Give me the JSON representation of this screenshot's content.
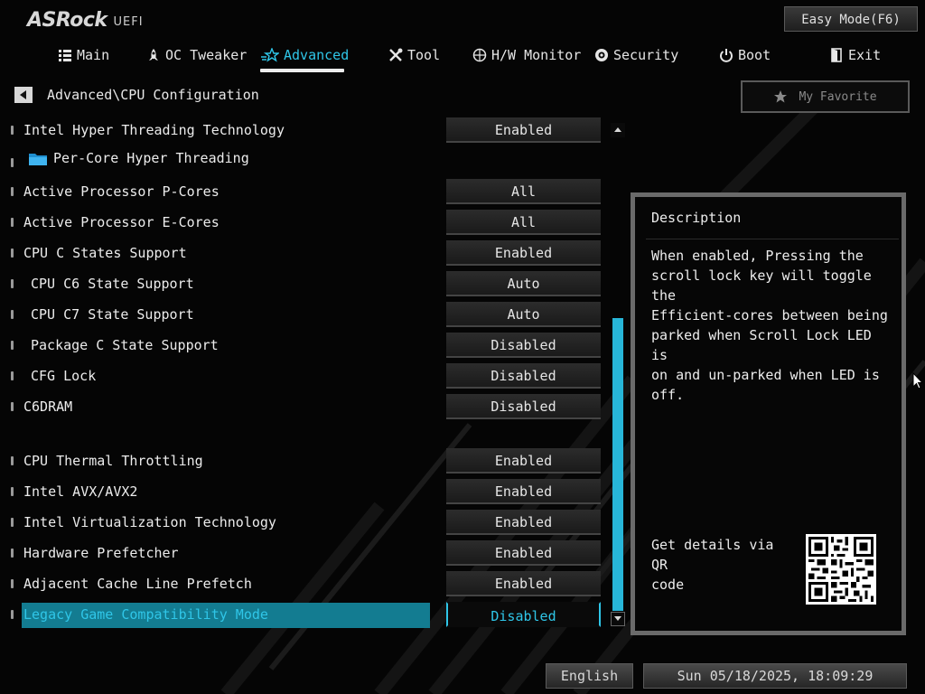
{
  "app": {
    "brand": "ASRock",
    "product": "UEFI"
  },
  "header": {
    "easy_mode_label": "Easy Mode(F6)"
  },
  "nav": {
    "tabs": [
      {
        "label": "Main",
        "icon": "list-icon"
      },
      {
        "label": "OC Tweaker",
        "icon": "rocket-icon"
      },
      {
        "label": "Advanced",
        "icon": "star-icon",
        "active": true
      },
      {
        "label": "Tool",
        "icon": "tools-icon"
      },
      {
        "label": "H/W Monitor",
        "icon": "monitor-icon"
      },
      {
        "label": "Security",
        "icon": "shield-icon"
      },
      {
        "label": "Boot",
        "icon": "power-icon"
      },
      {
        "label": "Exit",
        "icon": "exit-door-icon"
      }
    ]
  },
  "breadcrumb": {
    "path": "Advanced\\CPU Configuration"
  },
  "favorite": {
    "label": "My Favorite"
  },
  "settings": [
    {
      "label": "Intel Hyper Threading Technology",
      "value": "Enabled"
    },
    {
      "label": "Per-Core Hyper Threading",
      "value": null,
      "folder": true
    },
    {
      "label": "Active Processor P-Cores",
      "value": "All"
    },
    {
      "label": "Active Processor E-Cores",
      "value": "All"
    },
    {
      "label": "CPU C States Support",
      "value": "Enabled"
    },
    {
      "label": "CPU C6 State Support",
      "value": "Auto",
      "indent": true
    },
    {
      "label": "CPU C7 State Support",
      "value": "Auto",
      "indent": true
    },
    {
      "label": "Package C State Support",
      "value": "Disabled",
      "indent": true
    },
    {
      "label": "CFG Lock",
      "value": "Disabled",
      "indent": true
    },
    {
      "label": "C6DRAM",
      "value": "Disabled"
    },
    {
      "label": "CPU Thermal Throttling",
      "value": "Enabled"
    },
    {
      "label": "Intel AVX/AVX2",
      "value": "Enabled"
    },
    {
      "label": "Intel Virtualization Technology",
      "value": "Enabled"
    },
    {
      "label": "Hardware Prefetcher",
      "value": "Enabled"
    },
    {
      "label": "Adjacent Cache Line Prefetch",
      "value": "Enabled"
    },
    {
      "label": "Legacy Game Compatibility Mode",
      "value": "Disabled",
      "selected": true
    }
  ],
  "description": {
    "title": "Description",
    "text": "When enabled, Pressing the\nscroll lock key will toggle the\nEfficient-cores between being\nparked when Scroll Lock LED is\non and un-parked when LED is\noff.",
    "qr_caption": "Get details via QR\ncode"
  },
  "footer": {
    "language": "English",
    "datetime": "Sun 05/18/2025, 18:09:29"
  },
  "colors": {
    "accent": "#2fc6e8",
    "selected_row": "#137c91",
    "scroll_thumb": "#27b6d9"
  }
}
